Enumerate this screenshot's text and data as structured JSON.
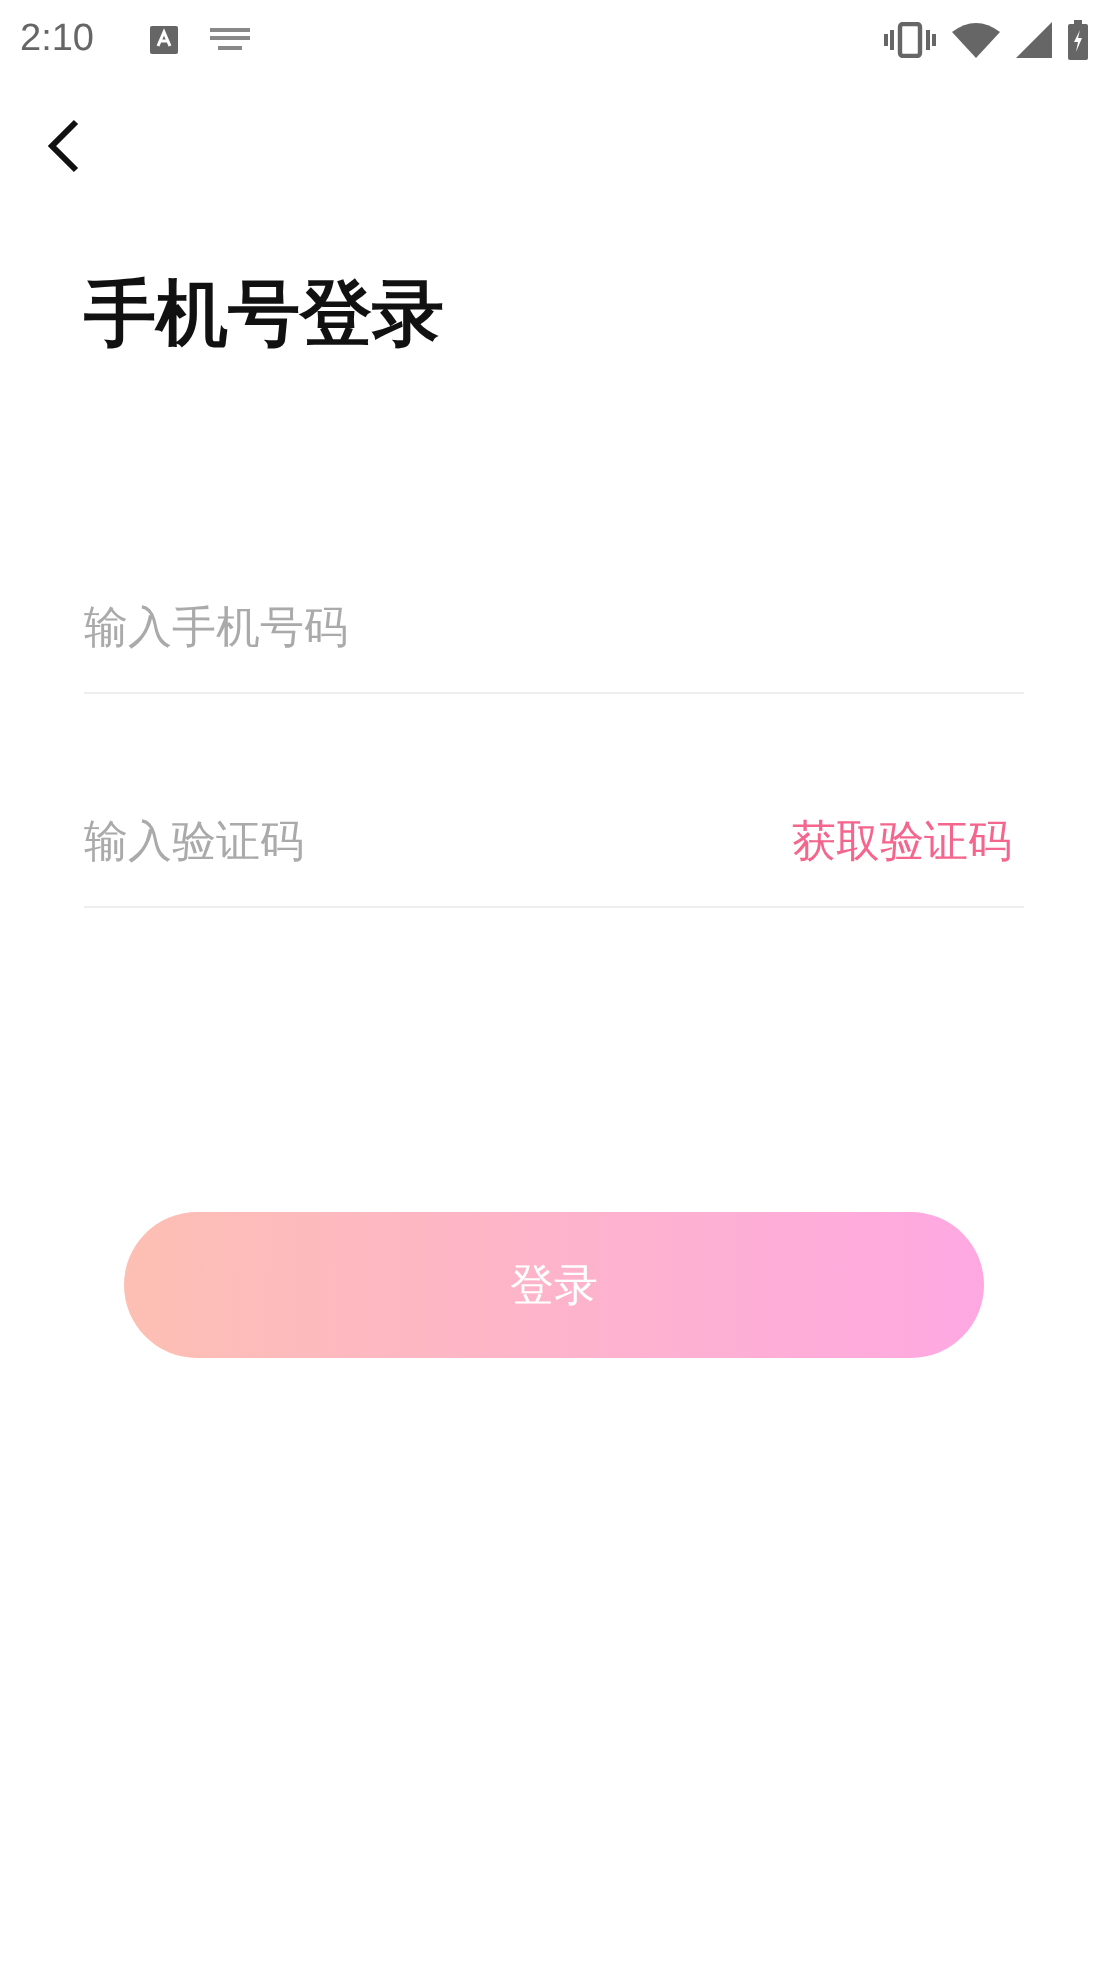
{
  "status_bar": {
    "time": "2:10"
  },
  "title": "手机号登录",
  "phone_field": {
    "placeholder": "输入手机号码"
  },
  "code_field": {
    "placeholder": "输入验证码",
    "action": "获取验证码"
  },
  "login_button": {
    "label": "登录",
    "disabled": true
  }
}
